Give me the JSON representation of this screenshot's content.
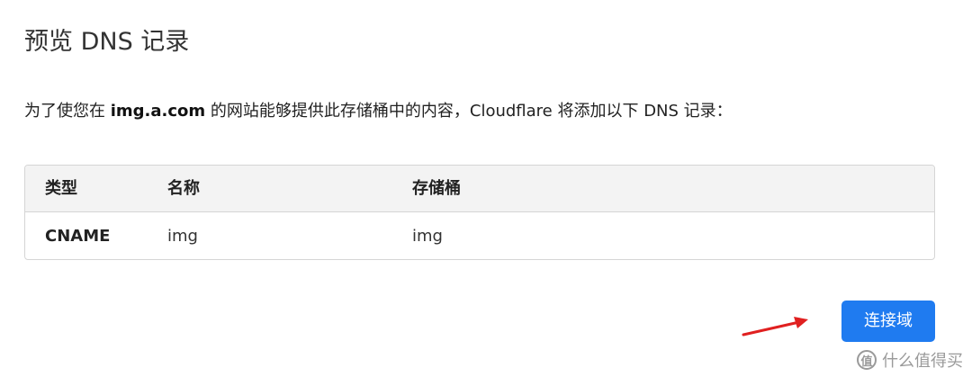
{
  "page": {
    "title": "预览 DNS 记录",
    "description_prefix": "为了使您在 ",
    "description_domain": "img.a.com",
    "description_suffix": " 的网站能够提供此存储桶中的内容，Cloudflare 将添加以下 DNS 记录："
  },
  "table": {
    "headers": [
      "类型",
      "名称",
      "存储桶"
    ],
    "rows": [
      [
        "CNAME",
        "img",
        "img"
      ]
    ]
  },
  "actions": {
    "connect_domain_label": "连接域"
  },
  "annotation": {
    "arrow_color": "#e02020"
  },
  "watermark": {
    "logo_glyph": "值",
    "text": "什么值得买"
  },
  "colors": {
    "primary_button": "#1f7bf0",
    "header_background": "#f3f3f3",
    "border": "#d5d5d5"
  }
}
